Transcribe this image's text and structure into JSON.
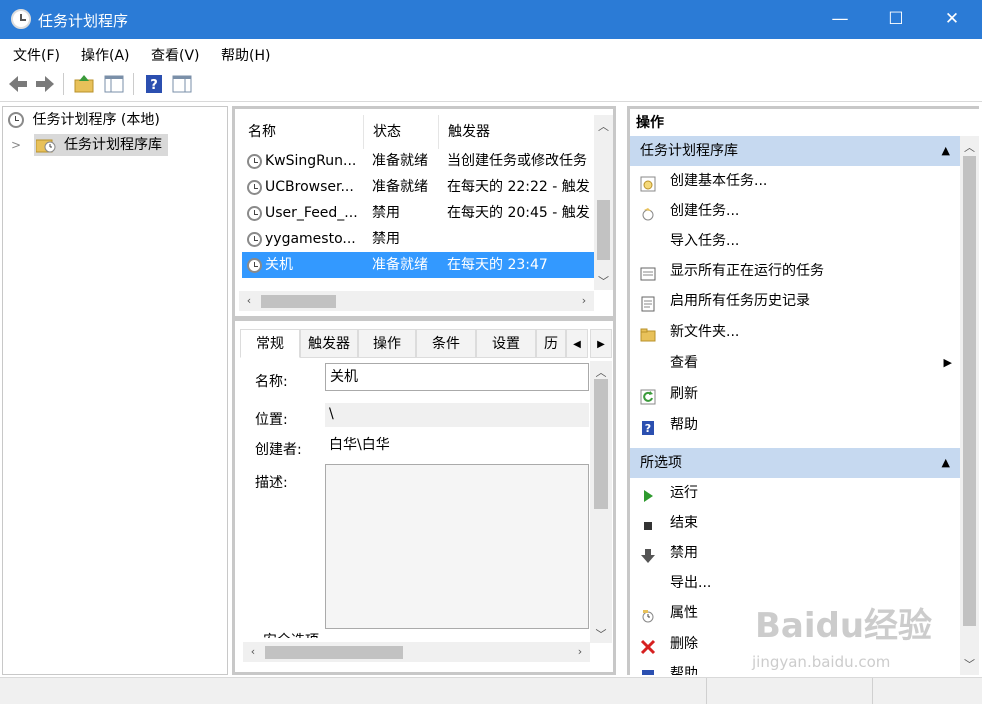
{
  "window": {
    "title": "任务计划程序",
    "minimize": "—",
    "maximize": "☐",
    "close": "✕"
  },
  "menu": [
    "文件(F)",
    "操作(A)",
    "查看(V)",
    "帮助(H)"
  ],
  "tree": {
    "root": "任务计划程序 (本地)",
    "library": "任务计划程序库",
    "expander": ">"
  },
  "task_list": {
    "columns": [
      "名称",
      "状态",
      "触发器"
    ],
    "rows": [
      {
        "name": "KwSingRun...",
        "status": "准备就绪",
        "trigger": "当创建任务或修改任务"
      },
      {
        "name": "UCBrowser...",
        "status": "准备就绪",
        "trigger": "在每天的 22:22 - 触发"
      },
      {
        "name": "User_Feed_...",
        "status": "禁用",
        "trigger": "在每天的 20:45 - 触发"
      },
      {
        "name": "yygamesto...",
        "status": "禁用",
        "trigger": ""
      },
      {
        "name": "关机",
        "status": "准备就绪",
        "trigger": "在每天的 23:47"
      }
    ],
    "selected_index": 4
  },
  "details": {
    "tabs": [
      "常规",
      "触发器",
      "操作",
      "条件",
      "设置",
      "历"
    ],
    "active_tab": "常规",
    "name_label": "名称:",
    "name_value": "关机",
    "location_label": "位置:",
    "location_value": "\\",
    "author_label": "创建者:",
    "author_value": "白华\\白华",
    "description_label": "描述:",
    "security_label": "安全选项"
  },
  "actions": {
    "title": "操作",
    "section1": {
      "label": "任务计划程序库",
      "items": [
        "创建基本任务...",
        "创建任务...",
        "导入任务...",
        "显示所有正在运行的任务",
        "启用所有任务历史记录",
        "新文件夹...",
        "查看",
        "刷新",
        "帮助"
      ]
    },
    "section2": {
      "label": "所选项",
      "items": [
        "运行",
        "结束",
        "禁用",
        "导出...",
        "属性",
        "删除",
        "帮助"
      ]
    }
  },
  "watermark": {
    "brand": "Baidu经验",
    "url": "jingyan.baidu.com"
  },
  "colors": {
    "titlebar": "#2b7bd6",
    "selection": "#3399ff",
    "section_header": "#c6d9f0"
  }
}
